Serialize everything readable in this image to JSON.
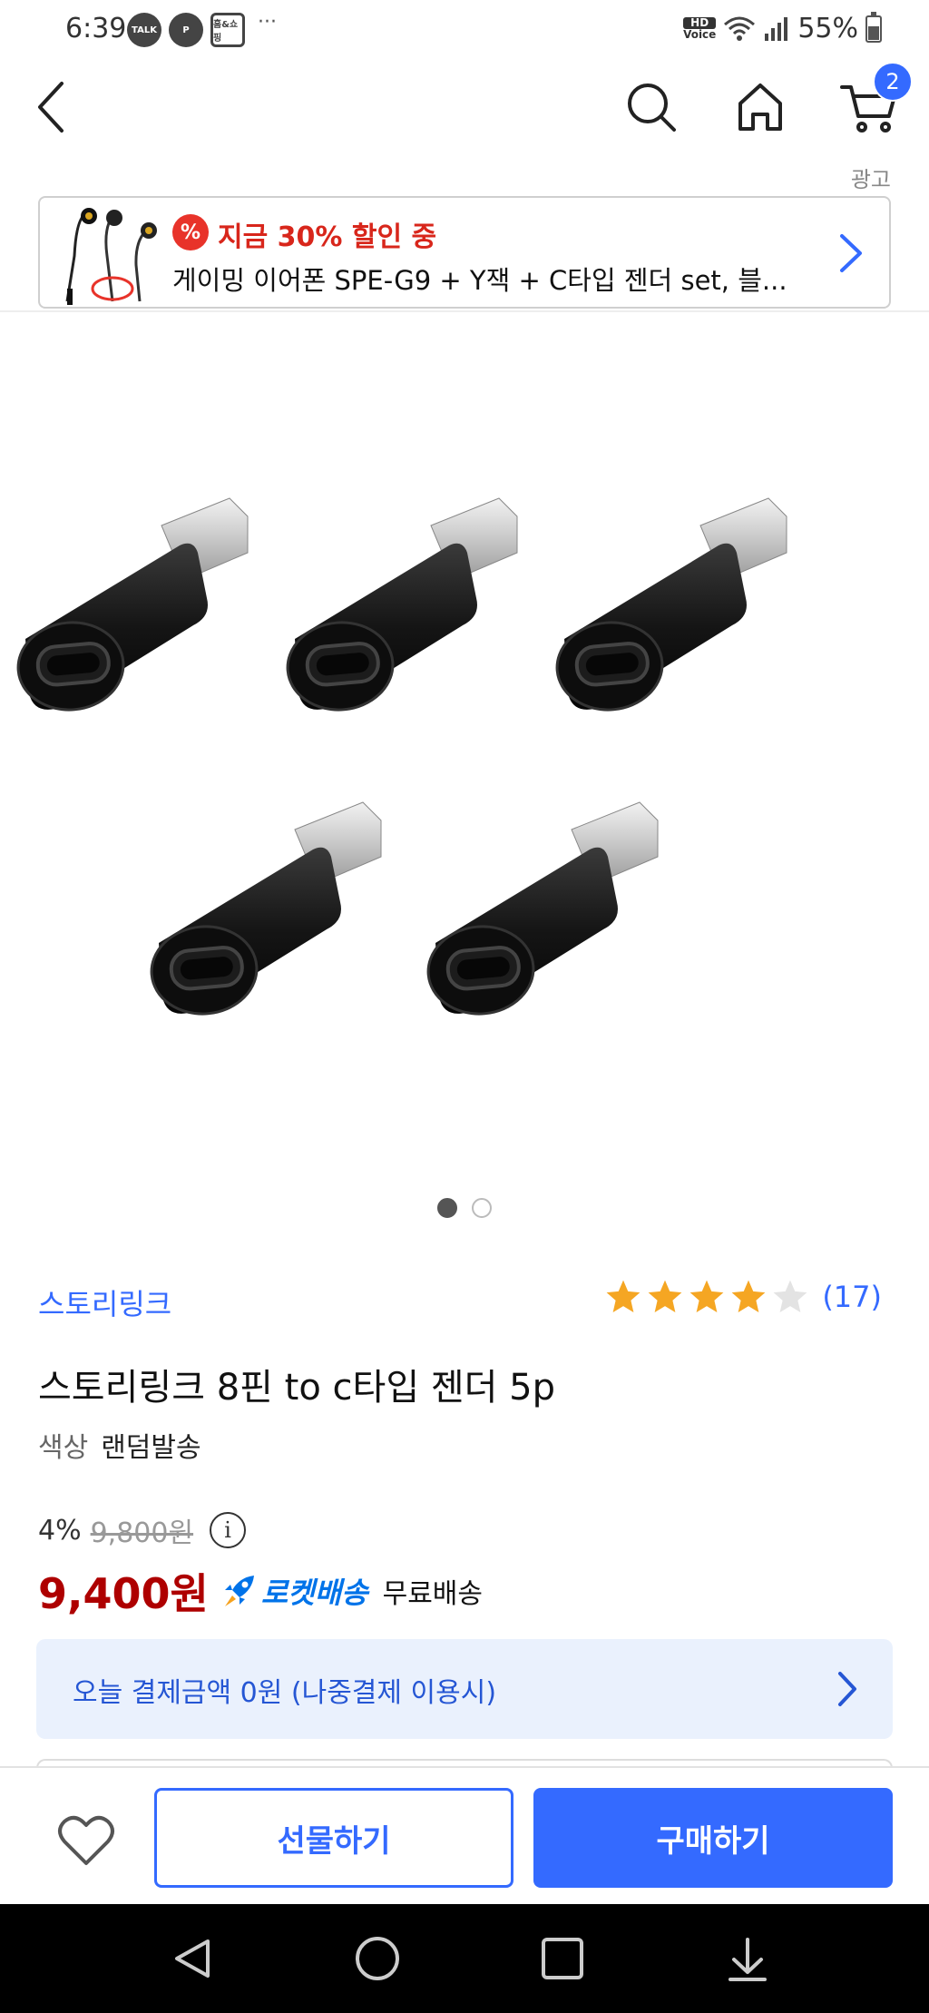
{
  "status_bar": {
    "time": "6:39",
    "app_icons": [
      "TALK",
      "P",
      "홈&쇼핑"
    ],
    "more": "···",
    "hd_top": "HD",
    "hd_bottom": "Voice",
    "battery": "55%"
  },
  "header": {
    "cart_count": "2"
  },
  "ad": {
    "label": "광고",
    "badge": "%",
    "promo": "지금 30% 할인 중",
    "title": "게이밍 이어폰 SPE-G9 + Y잭 + C타입 젠더 set, 블..."
  },
  "gallery": {
    "pages": 2,
    "active_index": 0
  },
  "product": {
    "brand": "스토리링크",
    "rating": 4,
    "rating_max": 5,
    "review_count": "(17)",
    "title": "스토리링크 8핀 to c타입 젠더 5p",
    "option_label": "색상",
    "option_value": "랜덤발송",
    "discount_rate": "4%",
    "original_price": "9,800원",
    "info_symbol": "i",
    "sale_price": "9,400원",
    "delivery_badge": "로켓배송",
    "shipping": "무료배송"
  },
  "paylater": {
    "text": "오늘 결제금액 0원 (나중결제 이용시)"
  },
  "actions": {
    "gift": "선물하기",
    "buy": "구매하기"
  },
  "colors": {
    "accent": "#346aff",
    "sale": "#ae0000",
    "promo": "#d8261b",
    "star": "#f5a623",
    "rocket": "#0073e9"
  }
}
